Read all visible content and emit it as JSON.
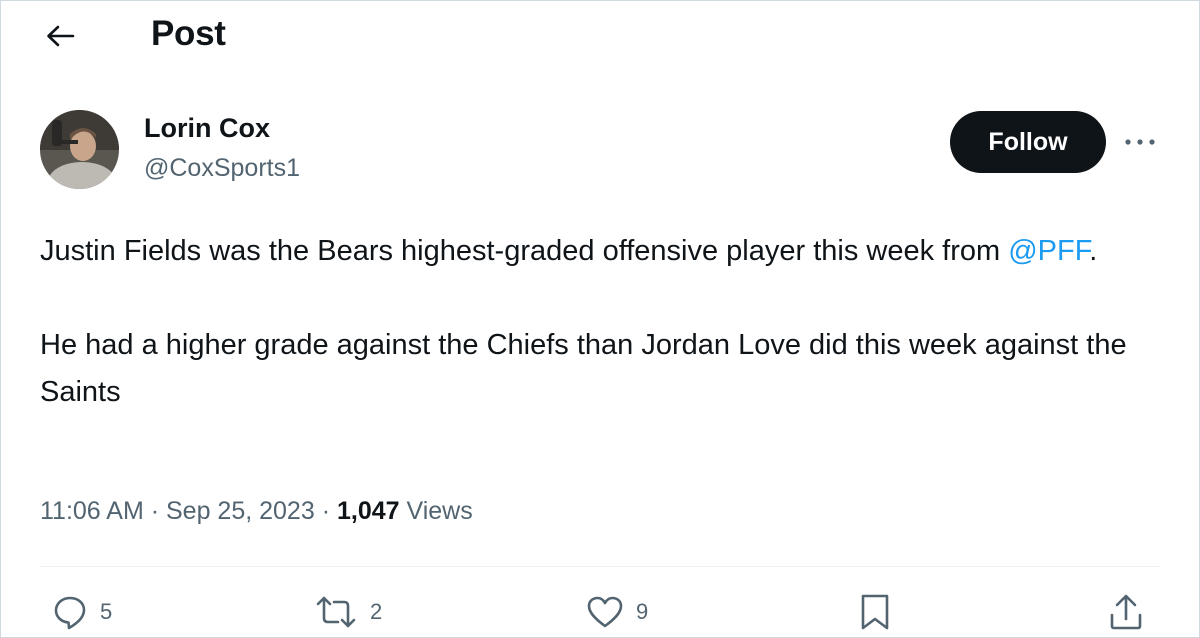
{
  "header": {
    "title": "Post",
    "back_icon": "arrow-left-icon"
  },
  "author": {
    "display_name": "Lorin Cox",
    "handle": "@CoxSports1",
    "avatar_icon": "user-avatar"
  },
  "follow_label": "Follow",
  "more_icon": "more-horizontal-icon",
  "tweet": {
    "line1_prefix": "Justin Fields was the Bears highest-graded offensive player this week from ",
    "mention": "@PFF",
    "line1_suffix": ".",
    "paragraph2": "He had a higher grade against the Chiefs than Jordan Love did this week against the Saints"
  },
  "meta": {
    "time": "11:06 AM",
    "separator": " · ",
    "date": "Sep 25, 2023",
    "views_count": "1,047",
    "views_label": "Views"
  },
  "actions": {
    "replies": {
      "icon": "reply-icon",
      "count": "5"
    },
    "reposts": {
      "icon": "repost-icon",
      "count": "2"
    },
    "likes": {
      "icon": "heart-icon",
      "count": "9"
    },
    "bookmark": {
      "icon": "bookmark-icon"
    },
    "share": {
      "icon": "share-icon"
    }
  },
  "colors": {
    "accent": "#1d9bf0",
    "text_primary": "#0f1419",
    "text_secondary": "#536471",
    "button_bg": "#0f1419"
  }
}
